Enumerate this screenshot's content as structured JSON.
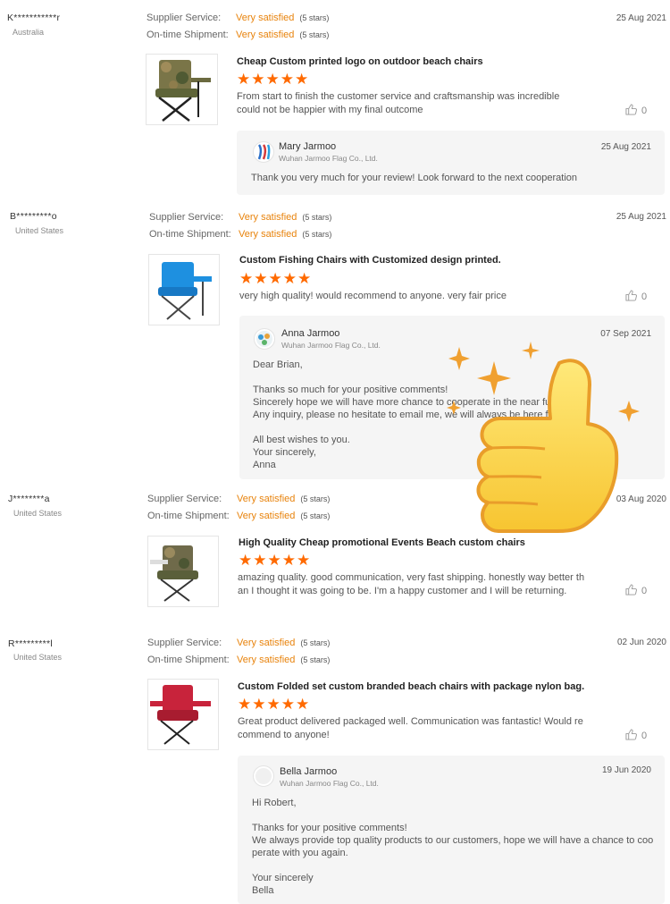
{
  "labels": {
    "supplier_service": "Supplier Service:",
    "on_time_shipment": "On-time Shipment:",
    "very_satisfied": "Very satisfied",
    "five_stars": "(5 stars)",
    "stars": "★★★★★"
  },
  "reviews": [
    {
      "name": "K***********r",
      "country": "Australia",
      "date": "25 Aug 2021",
      "title": "Cheap Custom printed logo on outdoor beach chairs",
      "comment": "From start to finish the customer service and craftsmanship was incredible could not be happier with my final outcome",
      "likes": "0",
      "reply": {
        "name": "Mary Jarmoo",
        "company": "Wuhan Jarmoo Flag Co., Ltd.",
        "date": "25 Aug 2021",
        "text": "Thank you very much for your review! Look forward to the next cooperation"
      }
    },
    {
      "name": "B*********o",
      "country": "United States",
      "date": "25 Aug 2021",
      "title": "Custom Fishing Chairs with Customized design printed.",
      "comment": "very high quality! would recommend to anyone. very fair price",
      "likes": "0",
      "reply": {
        "name": "Anna Jarmoo",
        "company": "Wuhan Jarmoo Flag Co., Ltd.",
        "date": "07 Sep 2021",
        "text": "Dear Brian,\n\nThanks so much for your positive comments!\nSincerely hope we will have more chance to cooperate in the near future.\nAny inquiry, please no hesitate to email me, we will always be here for you !\n\nAll best wishes to you.\nYour sincerely,\nAnna"
      }
    },
    {
      "name": "J********a",
      "country": "United States",
      "date": "03 Aug 2020",
      "title": "High Quality Cheap promotional Events Beach custom chairs",
      "comment": "amazing quality. good communication, very fast shipping.  honestly way better than I thought it was going to be. I'm a happy customer and I will be returning.",
      "likes": "0"
    },
    {
      "name": "R*********l",
      "country": "United States",
      "date": "02 Jun 2020",
      "title": "Custom Folded set custom branded beach chairs with package nylon bag.",
      "comment": "Great product delivered packaged well.  Communication was fantastic!  Would recommend to anyone!",
      "likes": "0",
      "reply": {
        "name": "Bella Jarmoo",
        "company": "Wuhan Jarmoo Flag Co., Ltd.",
        "date": "19 Jun 2020",
        "text": "Hi Robert,\n\nThanks for your positive comments!\nWe always provide top quality products to our customers, hope we will have a chance to cooperate with you again.\n\nYour sincerely\nBella"
      }
    }
  ],
  "colors": {
    "accent_orange": "#e8830c",
    "star_orange": "#ff6a00",
    "reply_bg": "#f5f5f5"
  }
}
